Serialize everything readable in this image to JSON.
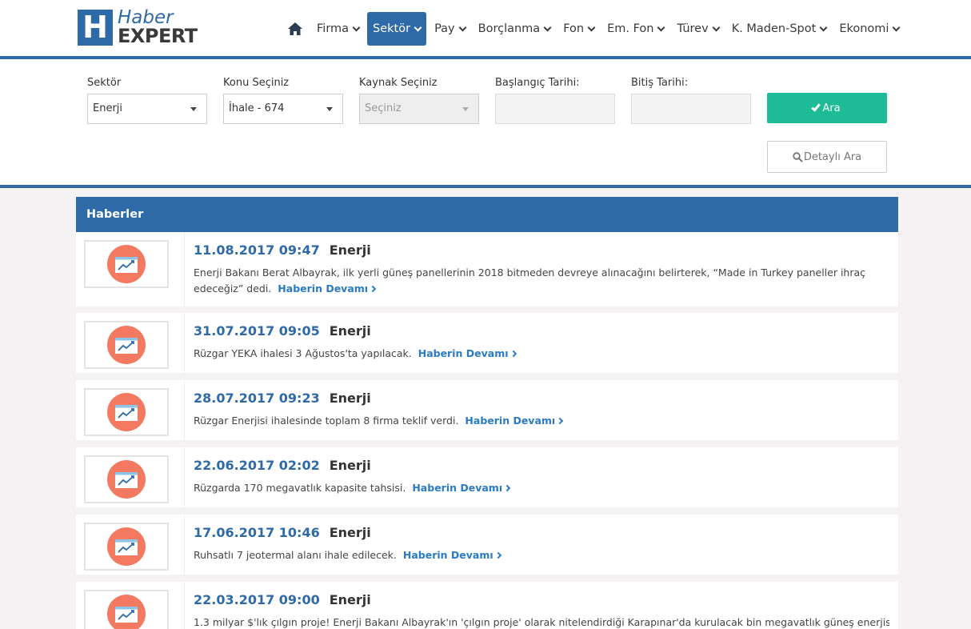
{
  "brand": {
    "logo_letter": "H",
    "name_top": "Haber",
    "name_bottom": "EXPERT",
    "color": "#2f6aa8"
  },
  "nav": {
    "home_icon": "home-icon",
    "items": [
      {
        "label": "Firma",
        "active": false
      },
      {
        "label": "Sektör",
        "active": true
      },
      {
        "label": "Pay",
        "active": false
      },
      {
        "label": "Borçlanma",
        "active": false
      },
      {
        "label": "Fon",
        "active": false
      },
      {
        "label": "Em. Fon",
        "active": false
      },
      {
        "label": "Türev",
        "active": false
      },
      {
        "label": "K. Maden-Spot",
        "active": false
      },
      {
        "label": "Ekonomi",
        "active": false
      }
    ]
  },
  "filter": {
    "sector_label": "Sektör",
    "sector_value": "Enerji",
    "topic_label": "Konu Seçiniz",
    "topic_value": "İhale - 674",
    "source_label": "Kaynak Seçiniz",
    "source_value": "Seçiniz",
    "start_label": "Başlangıç Tarihi:",
    "start_value": "",
    "end_label": "Bitiş Tarihi:",
    "end_value": "",
    "search_label": "Ara",
    "detail_label": "Detaylı Ara"
  },
  "news": {
    "title": "Haberler",
    "more_label": "Haberin Devamı",
    "items": [
      {
        "date": "11.08.2017 09:47",
        "category": "Enerji",
        "text": "Enerji Bakanı Berat Albayrak, ilk yerli güneş panellerinin 2018 bitmeden devreye alınacağını belirterek, “Made in Turkey paneller ihraç edeceğiz” dedi."
      },
      {
        "date": "31.07.2017 09:05",
        "category": "Enerji",
        "text": "Rüzgar YEKA ihalesi 3 Ağustos'ta yapılacak."
      },
      {
        "date": "28.07.2017 09:23",
        "category": "Enerji",
        "text": "Rüzgar Enerjisi ihalesinde toplam 8 firma teklif verdi."
      },
      {
        "date": "22.06.2017 02:02",
        "category": "Enerji",
        "text": "Rüzgarda 170 megavatlık kapasite tahsisi."
      },
      {
        "date": "17.06.2017 10:46",
        "category": "Enerji",
        "text": "Ruhsatlı 7 jeotermal alanı ihale edilecek."
      },
      {
        "date": "22.03.2017 09:00",
        "category": "Enerji",
        "text": "1.3 milyar $'lık çılgın proje! Enerji Bakanı Albayrak'ın 'çılgın proje' olarak nitelendirdiği Karapınar'da kurulacak bin megavatlık güneş enerjisi"
      }
    ]
  },
  "colors": {
    "primary": "#2f6aa8",
    "success": "#1dbb96",
    "link": "#2a7bc4",
    "thumb_circle": "#f37a60"
  }
}
